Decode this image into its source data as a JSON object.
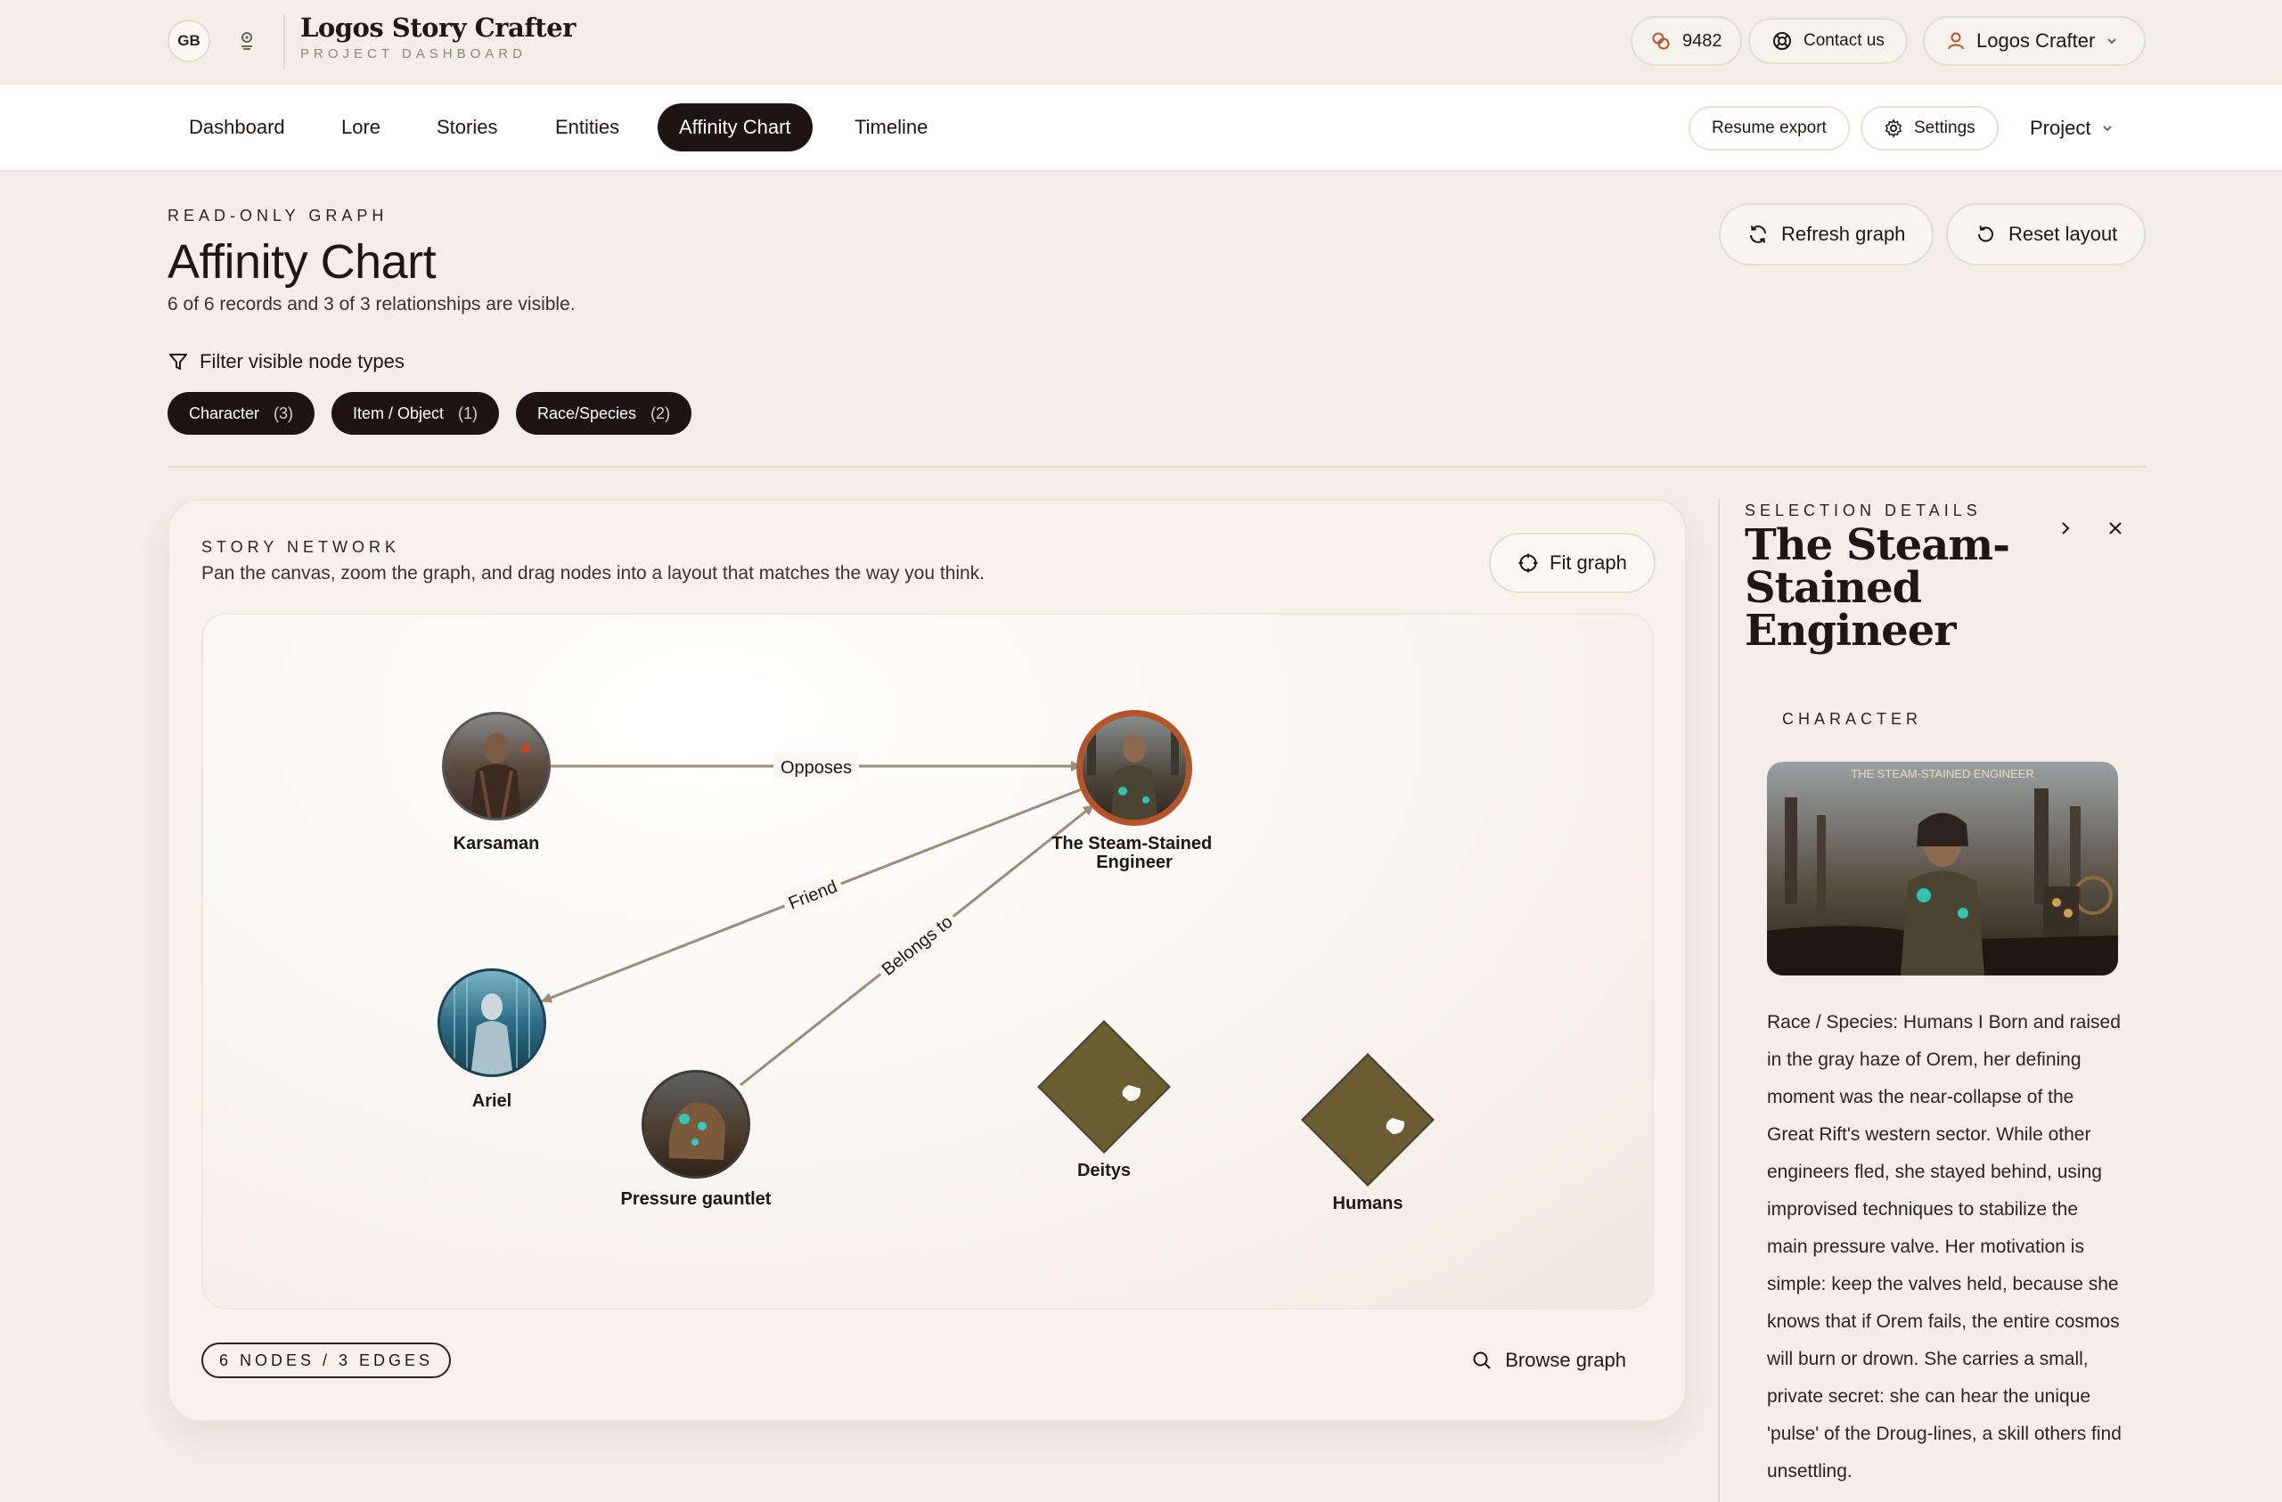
{
  "header": {
    "avatar_initials": "GB",
    "brand_title": "Logos Story Crafter",
    "brand_subtitle": "PROJECT DASHBOARD",
    "credits": "9482",
    "contact_label": "Contact us",
    "user_name": "Logos Crafter"
  },
  "nav": {
    "items": [
      "Dashboard",
      "Lore",
      "Stories",
      "Entities",
      "Affinity Chart",
      "Timeline"
    ],
    "active": "Affinity Chart",
    "resume_export": "Resume export",
    "settings": "Settings",
    "project": "Project"
  },
  "page": {
    "eyebrow": "READ-ONLY GRAPH",
    "title": "Affinity Chart",
    "subtitle": "6 of 6 records and 3 of 3 relationships are visible.",
    "refresh_label": "Refresh graph",
    "reset_label": "Reset layout",
    "filter_label": "Filter visible node types",
    "filters": [
      {
        "label": "Character",
        "count": "(3)"
      },
      {
        "label": "Item / Object",
        "count": "(1)"
      },
      {
        "label": "Race/Species",
        "count": "(2)"
      }
    ]
  },
  "network": {
    "eyebrow": "STORY NETWORK",
    "description": "Pan the canvas, zoom the graph, and drag nodes into a layout that matches the way you think.",
    "fit_label": "Fit graph",
    "count_badge": "6 NODES / 3 EDGES",
    "browse_label": "Browse graph",
    "nodes": [
      {
        "id": "karsaman",
        "label": "Karsaman",
        "type": "character"
      },
      {
        "id": "engineer",
        "label": "The Steam-Stained Engineer",
        "type": "character",
        "selected": true
      },
      {
        "id": "ariel",
        "label": "Ariel",
        "type": "character"
      },
      {
        "id": "gauntlet",
        "label": "Pressure gauntlet",
        "type": "item"
      },
      {
        "id": "deitys",
        "label": "Deitys",
        "type": "race"
      },
      {
        "id": "humans",
        "label": "Humans",
        "type": "race"
      }
    ],
    "edges": [
      {
        "from": "karsaman",
        "to": "engineer",
        "label": "Opposes"
      },
      {
        "from": "engineer",
        "to": "ariel",
        "label": "Friend"
      },
      {
        "from": "gauntlet",
        "to": "engineer",
        "label": "Belongs to"
      }
    ],
    "colors": {
      "edge": "#9a8c7c",
      "selected_ring": "#b5532b",
      "race_node": "#6b5d32"
    }
  },
  "details": {
    "eyebrow": "SELECTION DETAILS",
    "title": "The Steam-Stained Engineer",
    "type": "CHARACTER",
    "image_caption": "THE STEAM-STAINED ENGINEER",
    "description": "Race / Species: Humans I Born and raised in the gray haze of Orem, her defining moment was the near-collapse of the Great Rift's western sector. While other engineers fled, she stayed behind, using improvised techniques to stabilize the main pressure valve. Her motivation is simple: keep the valves held, because she knows that if Orem fails, the entire cosmos will burn or drown. She carries a small, private secret: she can hear the unique 'pulse' of the Droug-lines, a skill others find unsettling."
  }
}
